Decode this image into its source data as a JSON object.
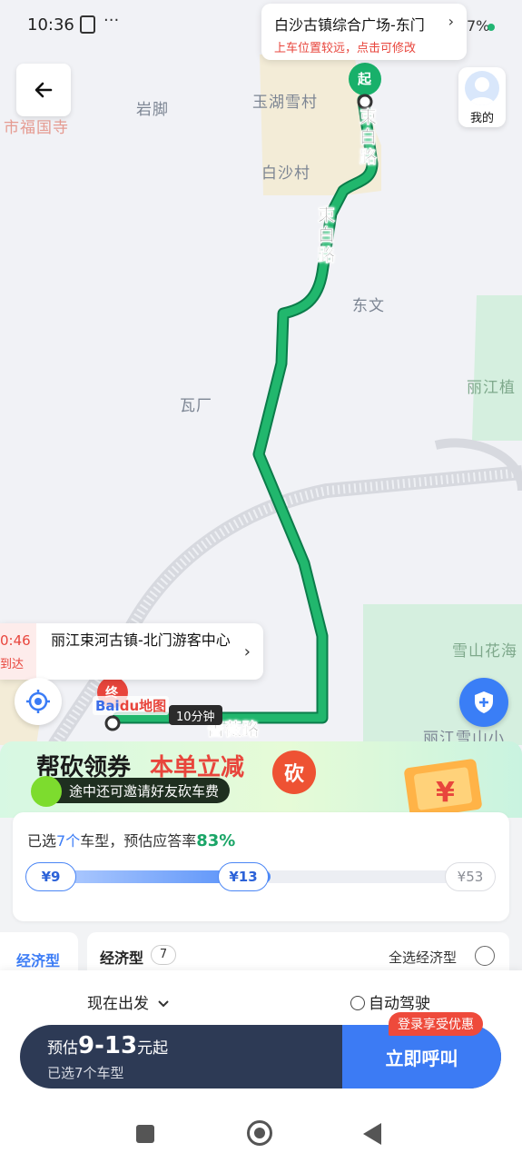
{
  "status_bar": {
    "time": "10:36",
    "more": "···",
    "battery": "7%"
  },
  "pickup": {
    "name": "白沙古镇综合广场-东门",
    "warning": "上车位置较远，点击可修改",
    "arrow": "›"
  },
  "me": {
    "label": "我的"
  },
  "map": {
    "places": [
      "岩脚",
      "玉湖雪村",
      "白沙村",
      "东文",
      "瓦厂",
      "市福国寺",
      "丽江植",
      "雪山花海",
      "丽江雪山小"
    ],
    "roads": [
      "束白路",
      "束白路",
      "蔷薇路"
    ],
    "start_marker": "起",
    "end_marker": "终",
    "baidu_logo": "Bai",
    "baidu_logo_b": "du地图",
    "duration": "10分钟"
  },
  "destination": {
    "eta_time": "0:46",
    "eta_sub": "到达",
    "name": "丽江束河古镇-北门游客中心",
    "arrow": "›"
  },
  "promo": {
    "title": "帮砍领券",
    "title_red": "本单立减",
    "subtitle": "途中还可邀请好友砍车费",
    "cut_label": "砍"
  },
  "range": {
    "hint_prefix": "已选",
    "hint_count": "7个",
    "hint_mid": "车型，预估应答率",
    "hint_rate": "83%",
    "min": "¥9",
    "current": "¥13",
    "max": "¥53",
    "fill_fraction": 0.52
  },
  "category": {
    "tab": "经济型",
    "name": "经济型",
    "count": "7",
    "select_all": "全选经济型"
  },
  "bottom": {
    "depart": "现在出发",
    "autodrive": "自动驾驶",
    "est_prefix": "预估",
    "est_range": "9-13",
    "est_suffix": "元起",
    "selected": "已选7个车型",
    "call": "立即呼叫",
    "login_tag": "登录享受优惠"
  }
}
